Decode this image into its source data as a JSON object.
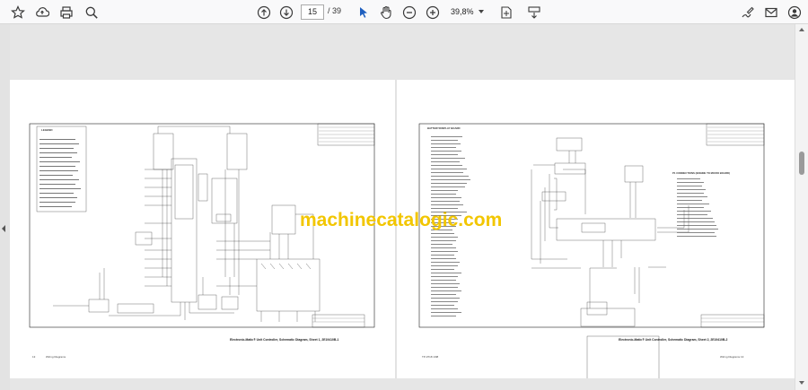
{
  "toolbar": {
    "current_page": "15",
    "page_separator": "/",
    "total_pages": "39",
    "zoom": "39,8%"
  },
  "icons": {
    "left": [
      "star-icon",
      "cloud-upload-icon",
      "print-icon",
      "zoom-search-icon"
    ],
    "nav": [
      "page-up-icon",
      "page-down-icon"
    ],
    "tools": [
      "select-arrow-icon",
      "hand-tool-icon",
      "zoom-out-icon",
      "zoom-in-icon",
      "fit-page-icon",
      "rotate-icon"
    ],
    "right": [
      "sign-icon",
      "mail-icon",
      "account-icon"
    ]
  },
  "document": {
    "watermark": "machinecatalogic.com",
    "left_page": {
      "caption": "Electronic-Matic® Unit Controller, Schematic Diagram, Sheet 1, 2E19410B-1",
      "legend_title": "LEGEND",
      "footer_left": "13",
      "footer_center": "Wiring Diagrams"
    },
    "right_page": {
      "caption": "Electronic-Matic® Unit Controller, Schematic Diagram, Sheet 2, 2E19410B-2",
      "section_title": "BATTERY/DISPLAY BOARD",
      "connector_title": "P1 CONNECTIONS (ENGINE TO MICRO BOARD)",
      "footer_left": "TP-0718 1/98",
      "footer_center": "Wiring Diagrams  13"
    }
  }
}
